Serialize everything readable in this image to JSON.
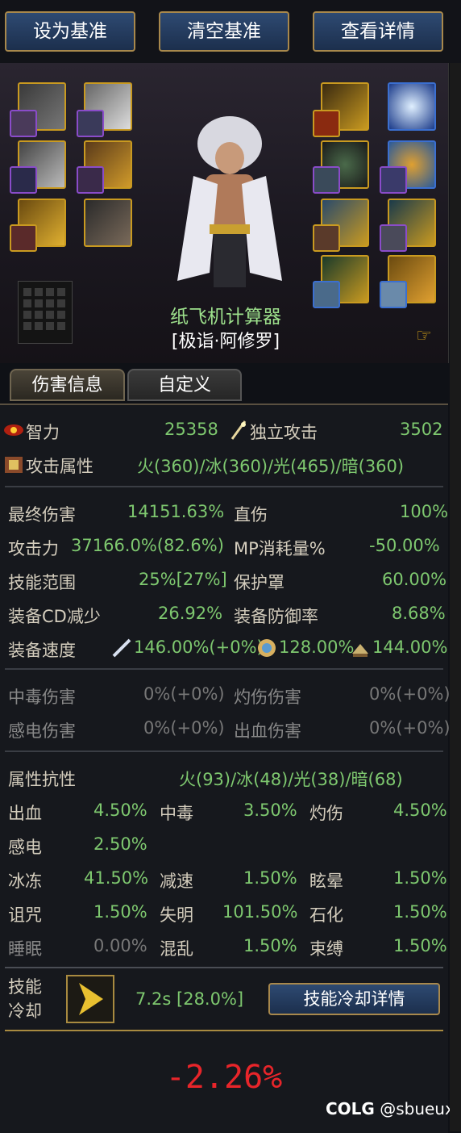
{
  "top_buttons": {
    "set_baseline": "设为基准",
    "clear_baseline": "清空基准",
    "view_details": "查看详情"
  },
  "character": {
    "name": "纸飞机计算器",
    "class": "[极诣·阿修罗]"
  },
  "tabs": {
    "damage_info": "伤害信息",
    "custom": "自定义"
  },
  "stats": {
    "intelligence_label": "智力",
    "intelligence_value": "25358",
    "independent_attack_label": "独立攻击",
    "independent_attack_value": "3502",
    "attack_element_label": "攻击属性",
    "attack_element_value": "火(360)/冰(360)/光(465)/暗(360)",
    "final_damage_label": "最终伤害",
    "final_damage_value": "14151.63%",
    "direct_damage_label": "直伤",
    "direct_damage_value": "100%",
    "attack_power_label": "攻击力",
    "attack_power_value": "37166.0%(82.6%)",
    "mp_cost_label": "MP消耗量%",
    "mp_cost_value": "-50.00%",
    "skill_range_label": "技能范围",
    "skill_range_value": "25%[27%]",
    "shield_label": "保护罩",
    "shield_value": "60.00%",
    "equip_cd_label": "装备CD减少",
    "equip_cd_value": "26.92%",
    "equip_defense_label": "装备防御率",
    "equip_defense_value": "8.68%",
    "equip_speed_label": "装备速度",
    "attack_speed_value": "146.00%(+0%)",
    "cast_speed_value": "128.00%",
    "move_speed_value": "144.00%",
    "poison_label": "中毒伤害",
    "poison_value": "0%(+0%)",
    "burn_label": "灼伤伤害",
    "burn_value": "0%(+0%)",
    "shock_label": "感电伤害",
    "shock_value": "0%(+0%)",
    "bleed_label": "出血伤害",
    "bleed_value": "0%(+0%)",
    "resist_label": "属性抗性",
    "resist_value": "火(93)/冰(48)/光(38)/暗(68)",
    "bleed2_label": "出血",
    "bleed2_value": "4.50%",
    "poison2_label": "中毒",
    "poison2_value": "3.50%",
    "burn2_label": "灼伤",
    "burn2_value": "4.50%",
    "shock2_label": "感电",
    "shock2_value": "2.50%",
    "freeze_label": "冰冻",
    "freeze_value": "41.50%",
    "slow_label": "减速",
    "slow_value": "1.50%",
    "stun_label": "眩晕",
    "stun_value": "1.50%",
    "curse_label": "诅咒",
    "curse_value": "1.50%",
    "blind_label": "失明",
    "blind_value": "101.50%",
    "petrify_label": "石化",
    "petrify_value": "1.50%",
    "sleep_label": "睡眠",
    "sleep_value": "0.00%",
    "confuse_label": "混乱",
    "confuse_value": "1.50%",
    "bind_label": "束缚",
    "bind_value": "1.50%"
  },
  "skill_cooldown": {
    "label_line1": "技能",
    "label_line2": "冷却",
    "value": "7.2s [28.0%]",
    "details_button": "技能冷却详情"
  },
  "result": {
    "value": "-2.26%"
  },
  "brand": {
    "logo": "COLG",
    "handle": "@sbueux"
  },
  "colors": {
    "accent_gold": "#a8884c",
    "button_blue": "#2e4a72",
    "value_green": "#7ec86f",
    "result_red": "#e8252a"
  }
}
